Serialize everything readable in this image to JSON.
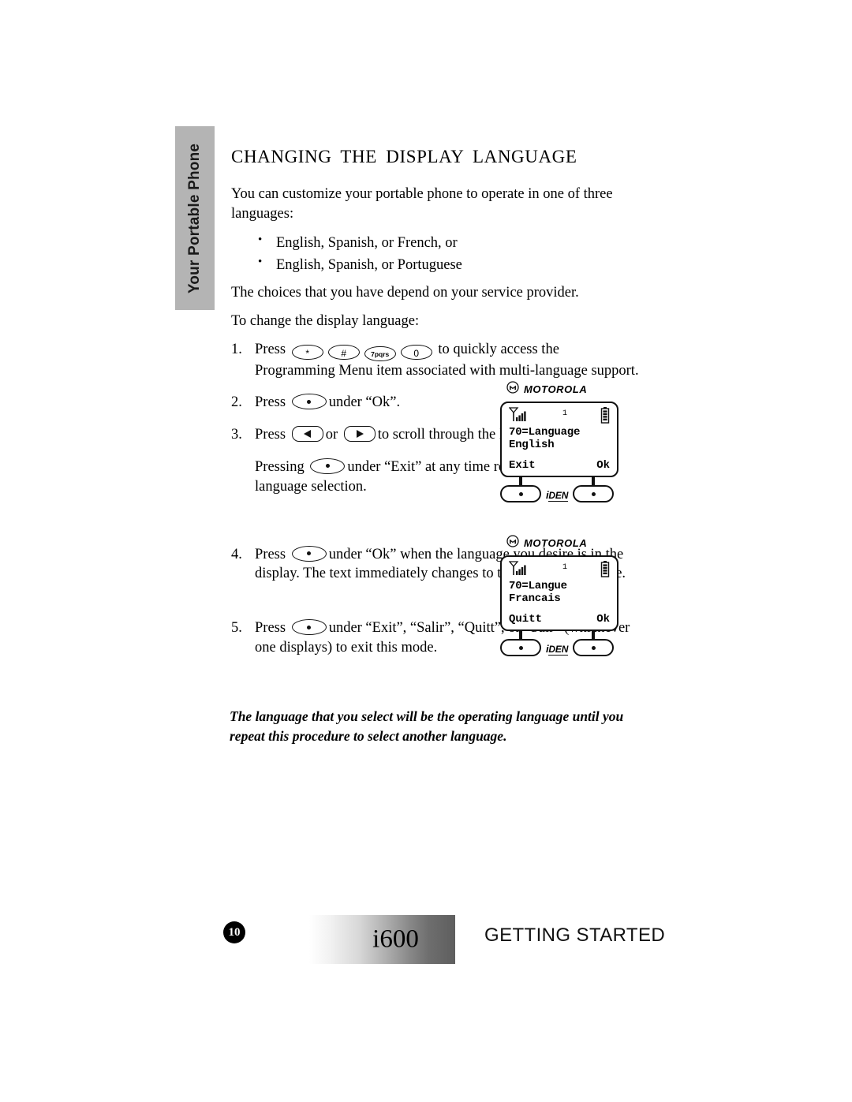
{
  "sidebar": {
    "tab_label": "Your Portable Phone"
  },
  "main": {
    "heading": "CHANGING THE DISPLAY LANGUAGE",
    "intro": "You can customize your portable phone to operate in one of three languages:",
    "language_options": [
      "English, Spanish, or French, or",
      "English, Spanish, or Portuguese"
    ],
    "provider_note": "The choices that you have depend on your service provider.",
    "lead_in": "To change the display language:",
    "steps": [
      {
        "number": "1.",
        "text_before": "Press",
        "keys": [
          "*",
          "#",
          "7pqrs",
          "0"
        ],
        "text_after": "to quickly access the Programming Menu item associated with multi-language support."
      },
      {
        "number": "2.",
        "text_before": "Press",
        "text_after": "under “Ok”."
      },
      {
        "number": "3.",
        "text_before": "Press",
        "text_middle": "or",
        "text_after": "to scroll through the language options."
      },
      {
        "number": "4.",
        "text_before": "Press",
        "text_after": "under “Ok” when the language you desire is in the display. The text immediately changes to the selected language."
      },
      {
        "number": "5.",
        "text_before": "Press",
        "text_after": "under “Exit”, “Salir”, “Quitt”, or “Sair” (whichever one displays) to exit this mode."
      }
    ],
    "exit_note": {
      "text_before": "Pressing",
      "text_after": "under “Exit” at any time retains the current language selection."
    },
    "closing_note": "The language that you select will be the operating language until you repeat this procedure to select another language."
  },
  "figures": [
    {
      "brand": "MOTOROLA",
      "status_indicator": "1",
      "display_line1": "70=Language",
      "display_line2": "English",
      "softkey_left": "Exit",
      "softkey_right": "Ok",
      "network_brand_i": "i",
      "network_brand_den": "DEN"
    },
    {
      "brand": "MOTOROLA",
      "status_indicator": "1",
      "display_line1": "70=Langue",
      "display_line2": "Francais",
      "softkey_left": "Quitt",
      "softkey_right": "Ok",
      "network_brand_i": "i",
      "network_brand_den": "DEN"
    }
  ],
  "footer": {
    "page_number": "10",
    "product": "i600",
    "section": "GETTING STARTED"
  }
}
